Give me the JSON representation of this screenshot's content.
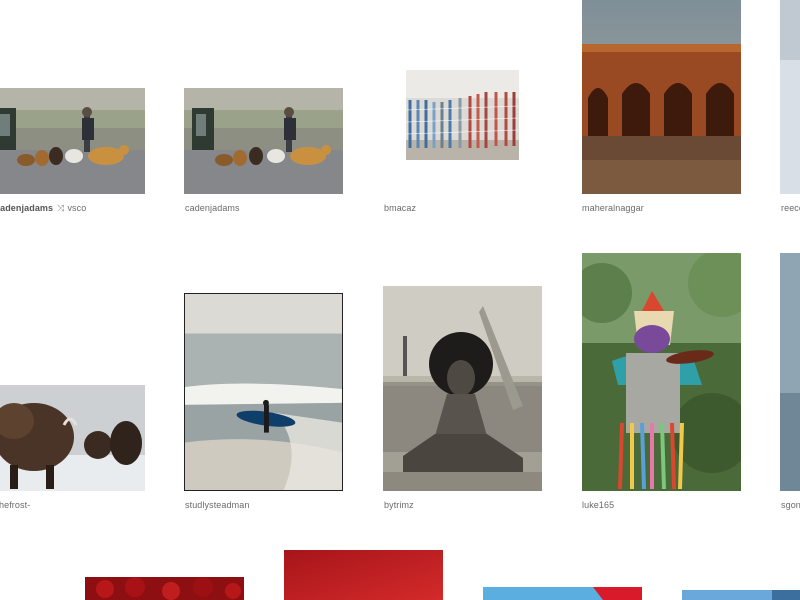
{
  "grid": {
    "items": [
      {
        "id": "r1c1",
        "caption_primary": "cadenjadams",
        "caption_secondary": "vsco",
        "repost_glyph": "⤨",
        "photo": "dogs-leash"
      },
      {
        "id": "r1c2",
        "caption_primary": "cadenjadams",
        "photo": "dogs-leash"
      },
      {
        "id": "r1c3",
        "caption_primary": "bmacaz",
        "photo": "stacked-chairs"
      },
      {
        "id": "r1c4",
        "caption_primary": "maheralnaggar",
        "photo": "brick-arches"
      },
      {
        "id": "r1c5",
        "caption_primary": "reece",
        "photo": "snow"
      },
      {
        "id": "r2c1",
        "caption_primary": "hefrost-",
        "photo": "bison-snow"
      },
      {
        "id": "r2c2",
        "caption_primary": "studlysteadman",
        "photo": "surfer-beach"
      },
      {
        "id": "r2c3",
        "caption_primary": "bytrimz",
        "photo": "woman-portrait-bw"
      },
      {
        "id": "r2c4",
        "caption_primary": "luke165",
        "photo": "masked-violinist"
      },
      {
        "id": "r2c5",
        "caption_primary": "sgon",
        "photo": "water"
      },
      {
        "id": "r3c1",
        "caption_primary": "",
        "photo": "red-roses"
      },
      {
        "id": "r3c2",
        "caption_primary": "",
        "photo": "red-gradient"
      },
      {
        "id": "r3c3",
        "caption_primary": "",
        "photo": "blue-red"
      },
      {
        "id": "r3c4",
        "caption_primary": "",
        "photo": "blue-sky"
      }
    ]
  },
  "colors": {
    "caption": "#6b6b6b",
    "background": "#ffffff"
  }
}
